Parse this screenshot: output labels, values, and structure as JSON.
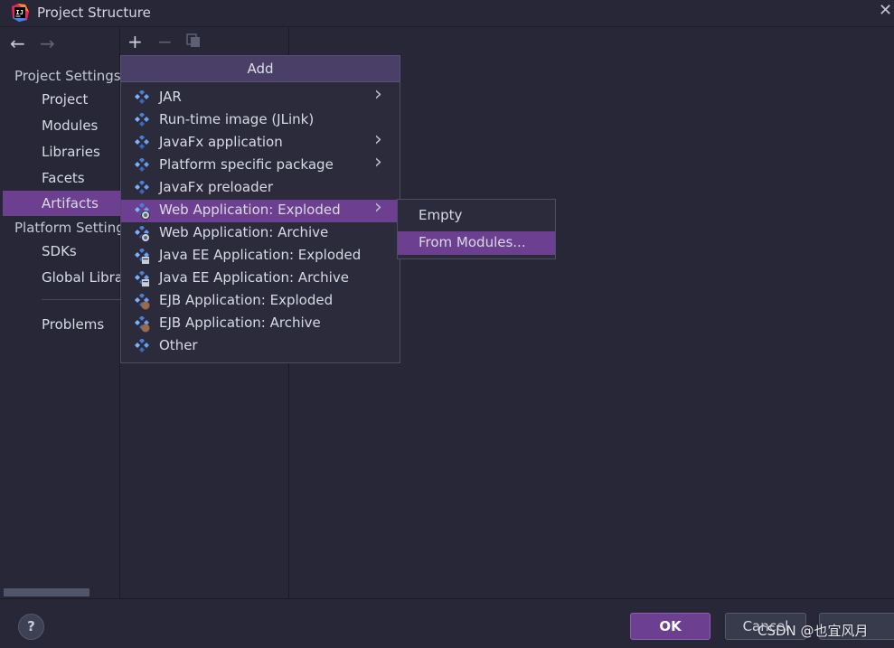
{
  "window": {
    "title": "Project Structure"
  },
  "colors": {
    "accent": "#6d3f90",
    "background": "#272738",
    "popup_header": "#4a3f66"
  },
  "sidebar": {
    "project_settings_label": "Project Settings",
    "project_items": [
      "Project",
      "Modules",
      "Libraries",
      "Facets",
      "Artifacts"
    ],
    "platform_settings_label": "Platform Settings",
    "platform_items": [
      "SDKs",
      "Global Libraries"
    ],
    "problems_label": "Problems",
    "selected": "Artifacts"
  },
  "add_menu": {
    "title": "Add",
    "items": [
      {
        "label": "JAR",
        "icon": "artifact-diamond-icon",
        "submenu": true
      },
      {
        "label": "Run-time image (JLink)",
        "icon": "artifact-diamond-icon",
        "submenu": false
      },
      {
        "label": "JavaFx application",
        "icon": "artifact-diamond-icon",
        "submenu": true
      },
      {
        "label": "Platform specific package",
        "icon": "artifact-diamond-icon",
        "submenu": true
      },
      {
        "label": "JavaFx preloader",
        "icon": "artifact-diamond-icon",
        "submenu": false
      },
      {
        "label": "Web Application: Exploded",
        "icon": "web-artifact-icon",
        "submenu": true,
        "selected": true
      },
      {
        "label": "Web Application: Archive",
        "icon": "web-artifact-icon",
        "submenu": false
      },
      {
        "label": "Java EE Application: Exploded",
        "icon": "javaee-artifact-icon",
        "submenu": false
      },
      {
        "label": "Java EE Application: Archive",
        "icon": "javaee-artifact-icon",
        "submenu": false
      },
      {
        "label": "EJB Application: Exploded",
        "icon": "ejb-artifact-icon",
        "submenu": false
      },
      {
        "label": "EJB Application: Archive",
        "icon": "ejb-artifact-icon",
        "submenu": false
      },
      {
        "label": "Other",
        "icon": "artifact-diamond-icon",
        "submenu": false
      }
    ]
  },
  "submenu": {
    "items": [
      {
        "label": "Empty"
      },
      {
        "label": "From Modules...",
        "selected": true
      }
    ]
  },
  "footer": {
    "help_label": "?",
    "ok_label": "OK",
    "cancel_label": "Cancel"
  },
  "watermark": "CSDN @也宜风月"
}
